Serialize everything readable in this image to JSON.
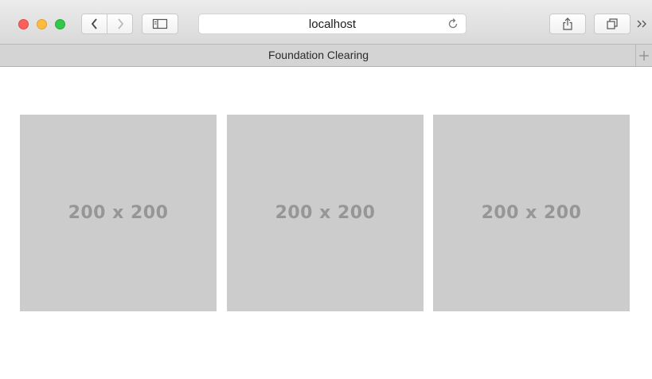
{
  "browser": {
    "address": "localhost",
    "tab_title": "Foundation Clearing"
  },
  "gallery": {
    "items": [
      {
        "label": "200 x 200"
      },
      {
        "label": "200 x 200"
      },
      {
        "label": "200 x 200"
      }
    ]
  }
}
